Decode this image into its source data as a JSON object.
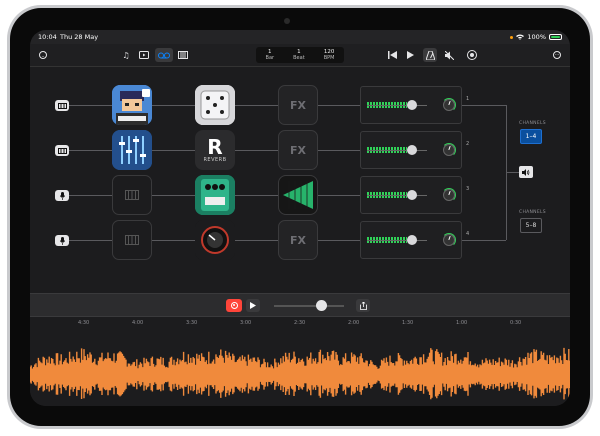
{
  "status": {
    "time": "10:04",
    "date": "Thu 28 May",
    "battery": "100%"
  },
  "toolbar": {
    "left_icon": "chevron-circle-icon",
    "mode_icons": [
      "music-notes-icon",
      "video-icon",
      "loop-icon",
      "keyboard-icon"
    ],
    "counter": {
      "bar_label": "Bar",
      "bar_value": "1",
      "beat_label": "Beat",
      "beat_value": "1",
      "bpm_label": "BPM",
      "bpm_value": "120"
    },
    "transport_icons": [
      "skip-back-icon",
      "play-icon",
      "metronome-icon",
      "mute-icon",
      "record-icon"
    ],
    "more_icon": "ellipsis-circle-icon"
  },
  "lanes": [
    {
      "input": "keyboard-icon",
      "instrument": "pixel-app",
      "effect": "dice-app",
      "fx3": "FX",
      "channel": "1"
    },
    {
      "input": "keyboard-icon",
      "instrument": "faders-app",
      "effect": "reverb-app",
      "fx3": "FX",
      "channel": "2"
    },
    {
      "input": "microphone-icon",
      "instrument": "empty-keyboard-slot",
      "effect": "pedal-app",
      "fx3": "filter-app",
      "channel": "3"
    },
    {
      "input": "microphone-icon",
      "instrument": "empty-keyboard-slot",
      "effect": "knob-app",
      "fx3": "FX",
      "channel": "4"
    }
  ],
  "apps": {
    "reverb_letter": "R",
    "reverb_word": "REVERB"
  },
  "output": {
    "channels_label_top": "CHANNELS",
    "channels_top": "1–4",
    "speaker_icon": "speaker-icon",
    "channels_label_bottom": "CHANNELS",
    "channels_bottom": "5–8"
  },
  "transport": {
    "record_icon": "record-icon",
    "play_icon": "play-icon",
    "share_icon": "share-icon"
  },
  "timeline": {
    "ticks": [
      "4:30",
      "4:00",
      "3:30",
      "3:00",
      "2:30",
      "2:00",
      "1:30",
      "1:00",
      "0:30"
    ]
  },
  "colors": {
    "accent": "#0a84ff",
    "record": "#ff453a",
    "meter": "#30d158",
    "waveform": "#f08a3c"
  }
}
